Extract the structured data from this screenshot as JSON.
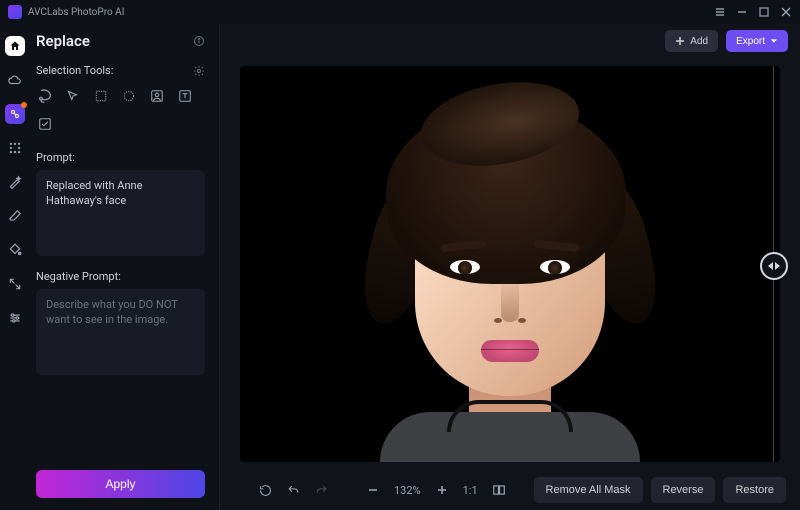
{
  "app": {
    "title": "AVCLabs PhotoPro AI"
  },
  "window_controls": [
    "menu",
    "minimize",
    "maximize",
    "close"
  ],
  "toolstrip": {
    "items": [
      {
        "name": "home-icon"
      },
      {
        "name": "cloud-upload-icon"
      },
      {
        "name": "ai-badge-icon"
      },
      {
        "name": "sparkle-grid-icon"
      },
      {
        "name": "magic-wand-icon"
      },
      {
        "name": "eraser-icon"
      },
      {
        "name": "paint-bucket-icon"
      },
      {
        "name": "expand-icon"
      },
      {
        "name": "sliders-icon"
      }
    ]
  },
  "panel": {
    "title": "Replace",
    "selection_label": "Selection Tools:",
    "selection_tools": [
      {
        "name": "lasso-tool-icon"
      },
      {
        "name": "pointer-tool-icon"
      },
      {
        "name": "rectangle-tool-icon"
      },
      {
        "name": "ellipse-tool-icon"
      },
      {
        "name": "person-select-icon"
      },
      {
        "name": "text-select-icon"
      },
      {
        "name": "auto-select-icon"
      }
    ],
    "prompt_label": "Prompt:",
    "prompt_value": "Replaced with Anne Hathaway's face",
    "neg_prompt_label": "Negative Prompt:",
    "neg_prompt_placeholder": "Describe what you DO NOT want to see in the image.",
    "apply_label": "Apply"
  },
  "topbar": {
    "add_label": "Add",
    "export_label": "Export"
  },
  "bottombar": {
    "zoom_text": "132%",
    "ratio_text": "1:1",
    "remove_mask_label": "Remove All Mask",
    "reverse_label": "Reverse",
    "restore_label": "Restore"
  }
}
